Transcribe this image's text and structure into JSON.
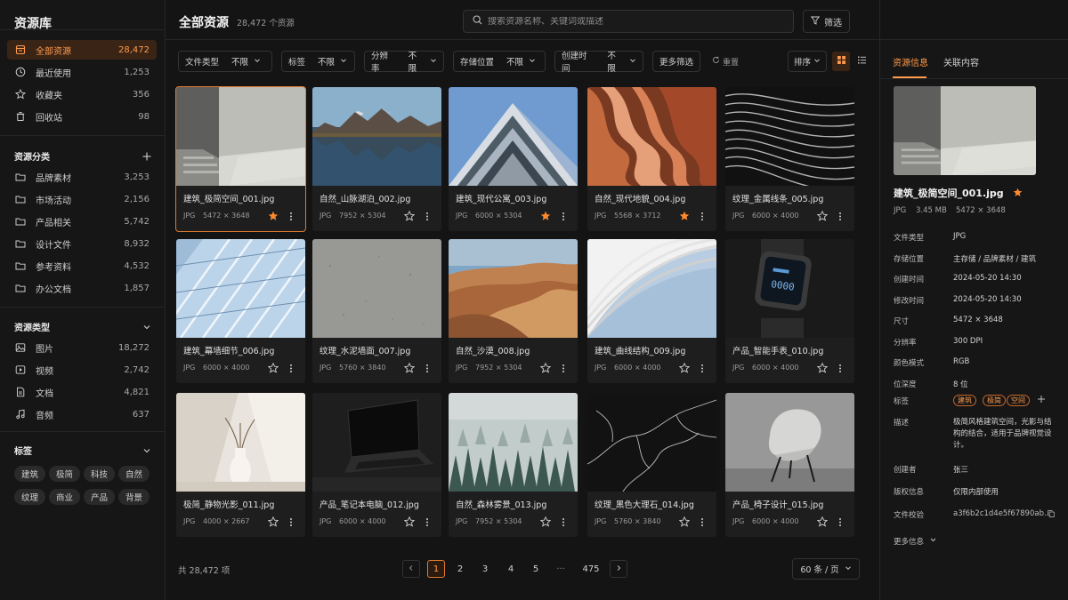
{
  "sidebar": {
    "title": "资源库",
    "nav": [
      {
        "label": "全部资源",
        "count": "28,472",
        "icon": "library-icon",
        "active": true
      },
      {
        "label": "最近使用",
        "count": "1,253",
        "icon": "clock-icon"
      },
      {
        "label": "收藏夹",
        "count": "356",
        "icon": "star-icon"
      },
      {
        "label": "回收站",
        "count": "98",
        "icon": "trash-icon"
      }
    ],
    "categories_title": "资源分类",
    "categories": [
      {
        "label": "品牌素材",
        "count": "3,253"
      },
      {
        "label": "市场活动",
        "count": "2,156"
      },
      {
        "label": "产品相关",
        "count": "5,742"
      },
      {
        "label": "设计文件",
        "count": "8,932"
      },
      {
        "label": "参考资料",
        "count": "4,532"
      },
      {
        "label": "办公文档",
        "count": "1,857"
      }
    ],
    "types_title": "资源类型",
    "types": [
      {
        "label": "图片",
        "count": "18,272",
        "icon": "image-icon"
      },
      {
        "label": "视频",
        "count": "2,742",
        "icon": "video-icon"
      },
      {
        "label": "文档",
        "count": "4,821",
        "icon": "document-icon"
      },
      {
        "label": "音频",
        "count": "637",
        "icon": "music-icon"
      }
    ],
    "tags_title": "标签",
    "tags": [
      "建筑",
      "极简",
      "科技",
      "自然",
      "纹理",
      "商业",
      "产品",
      "背景"
    ]
  },
  "header": {
    "title": "全部资源",
    "count": "28,472 个资源",
    "search_placeholder": "搜索资源名称、关键词或描述",
    "filter_label": "筛选"
  },
  "filters": [
    {
      "key": "文件类型",
      "value": "不限"
    },
    {
      "key": "标签",
      "value": "不限"
    },
    {
      "key": "分辨率",
      "value": "不限"
    },
    {
      "key": "存储位置",
      "value": "不限"
    },
    {
      "key": "创建时间",
      "value": "不限"
    }
  ],
  "more_filters": "更多筛选",
  "reset": "重置",
  "sort": "排序",
  "assets": [
    {
      "name": "建筑_极简空间_001.jpg",
      "format": "JPG",
      "dims": "5472 × 3648",
      "starred": true,
      "selected": true,
      "thumb": "concrete"
    },
    {
      "name": "自然_山脉湖泊_002.jpg",
      "format": "JPG",
      "dims": "7952 × 5304",
      "starred": false,
      "thumb": "lake"
    },
    {
      "name": "建筑_现代公寓_003.jpg",
      "format": "JPG",
      "dims": "6000 × 5304",
      "starred": true,
      "thumb": "apartment"
    },
    {
      "name": "自然_现代地貌_004.jpg",
      "format": "JPG",
      "dims": "5568 × 3712",
      "starred": true,
      "thumb": "canyon"
    },
    {
      "name": "纹理_金属线条_005.jpg",
      "format": "JPG",
      "dims": "6000 × 4000",
      "starred": false,
      "thumb": "lines"
    },
    {
      "name": "建筑_幕墙细节_006.jpg",
      "format": "JPG",
      "dims": "6000 × 4000",
      "starred": false,
      "thumb": "glass"
    },
    {
      "name": "纹理_水泥墙面_007.jpg",
      "format": "JPG",
      "dims": "5760 × 3840",
      "starred": false,
      "thumb": "cement"
    },
    {
      "name": "自然_沙漠_008.jpg",
      "format": "JPG",
      "dims": "7952 × 5304",
      "starred": false,
      "thumb": "desert"
    },
    {
      "name": "建筑_曲线结构_009.jpg",
      "format": "JPG",
      "dims": "6000 × 4000",
      "starred": false,
      "thumb": "curves"
    },
    {
      "name": "产品_智能手表_010.jpg",
      "format": "JPG",
      "dims": "6000 × 4000",
      "starred": false,
      "thumb": "watch"
    },
    {
      "name": "极简_静物光影_011.jpg",
      "format": "JPG",
      "dims": "4000 × 2667",
      "starred": false,
      "thumb": "vase"
    },
    {
      "name": "产品_笔记本电脑_012.jpg",
      "format": "JPG",
      "dims": "6000 × 4000",
      "starred": false,
      "thumb": "laptop"
    },
    {
      "name": "自然_森林雾景_013.jpg",
      "format": "JPG",
      "dims": "7952 × 5304",
      "starred": false,
      "thumb": "forest"
    },
    {
      "name": "纹理_黑色大理石_014.jpg",
      "format": "JPG",
      "dims": "5760 × 3840",
      "starred": false,
      "thumb": "marble"
    },
    {
      "name": "产品_椅子设计_015.jpg",
      "format": "JPG",
      "dims": "6000 × 4000",
      "starred": false,
      "thumb": "chair"
    }
  ],
  "footer": {
    "total": "共 28,472 项",
    "pages": [
      "1",
      "2",
      "3",
      "4",
      "5",
      "···",
      "475"
    ],
    "current_page": "1",
    "per_page": "60 条 / 页"
  },
  "detail": {
    "tabs": [
      "资源信息",
      "关联内容"
    ],
    "name": "建筑_极简空间_001.jpg",
    "format": "JPG",
    "size": "3.45 MB",
    "dims": "5472 × 3648",
    "rows": [
      {
        "k": "文件类型",
        "v": "JPG"
      },
      {
        "k": "存储位置",
        "v": "主存储 / 品牌素材 / 建筑"
      },
      {
        "k": "创建时间",
        "v": "2024-05-20 14:30"
      },
      {
        "k": "修改时间",
        "v": "2024-05-20 14:30"
      },
      {
        "k": "尺寸",
        "v": "5472 × 3648"
      },
      {
        "k": "分辨率",
        "v": "300 DPI"
      },
      {
        "k": "颜色模式",
        "v": "RGB"
      },
      {
        "k": "位深度",
        "v": "8 位"
      }
    ],
    "tags_label": "标签",
    "tags": [
      "建筑",
      "极简",
      "空间"
    ],
    "desc_label": "描述",
    "desc": "极简风格建筑空间，光影与结构的结合，适用于品牌视觉设计。",
    "creator_label": "创建者",
    "creator": "张三",
    "copyright_label": "版权信息",
    "copyright": "仅限内部使用",
    "checksum_label": "文件校验",
    "checksum": "a3f6b2c1d4e5f67890ab...",
    "more_info": "更多信息"
  },
  "colors": {
    "accent": "#ff9a4a",
    "accent_bg": "#3a2416",
    "bg": "#141414"
  }
}
